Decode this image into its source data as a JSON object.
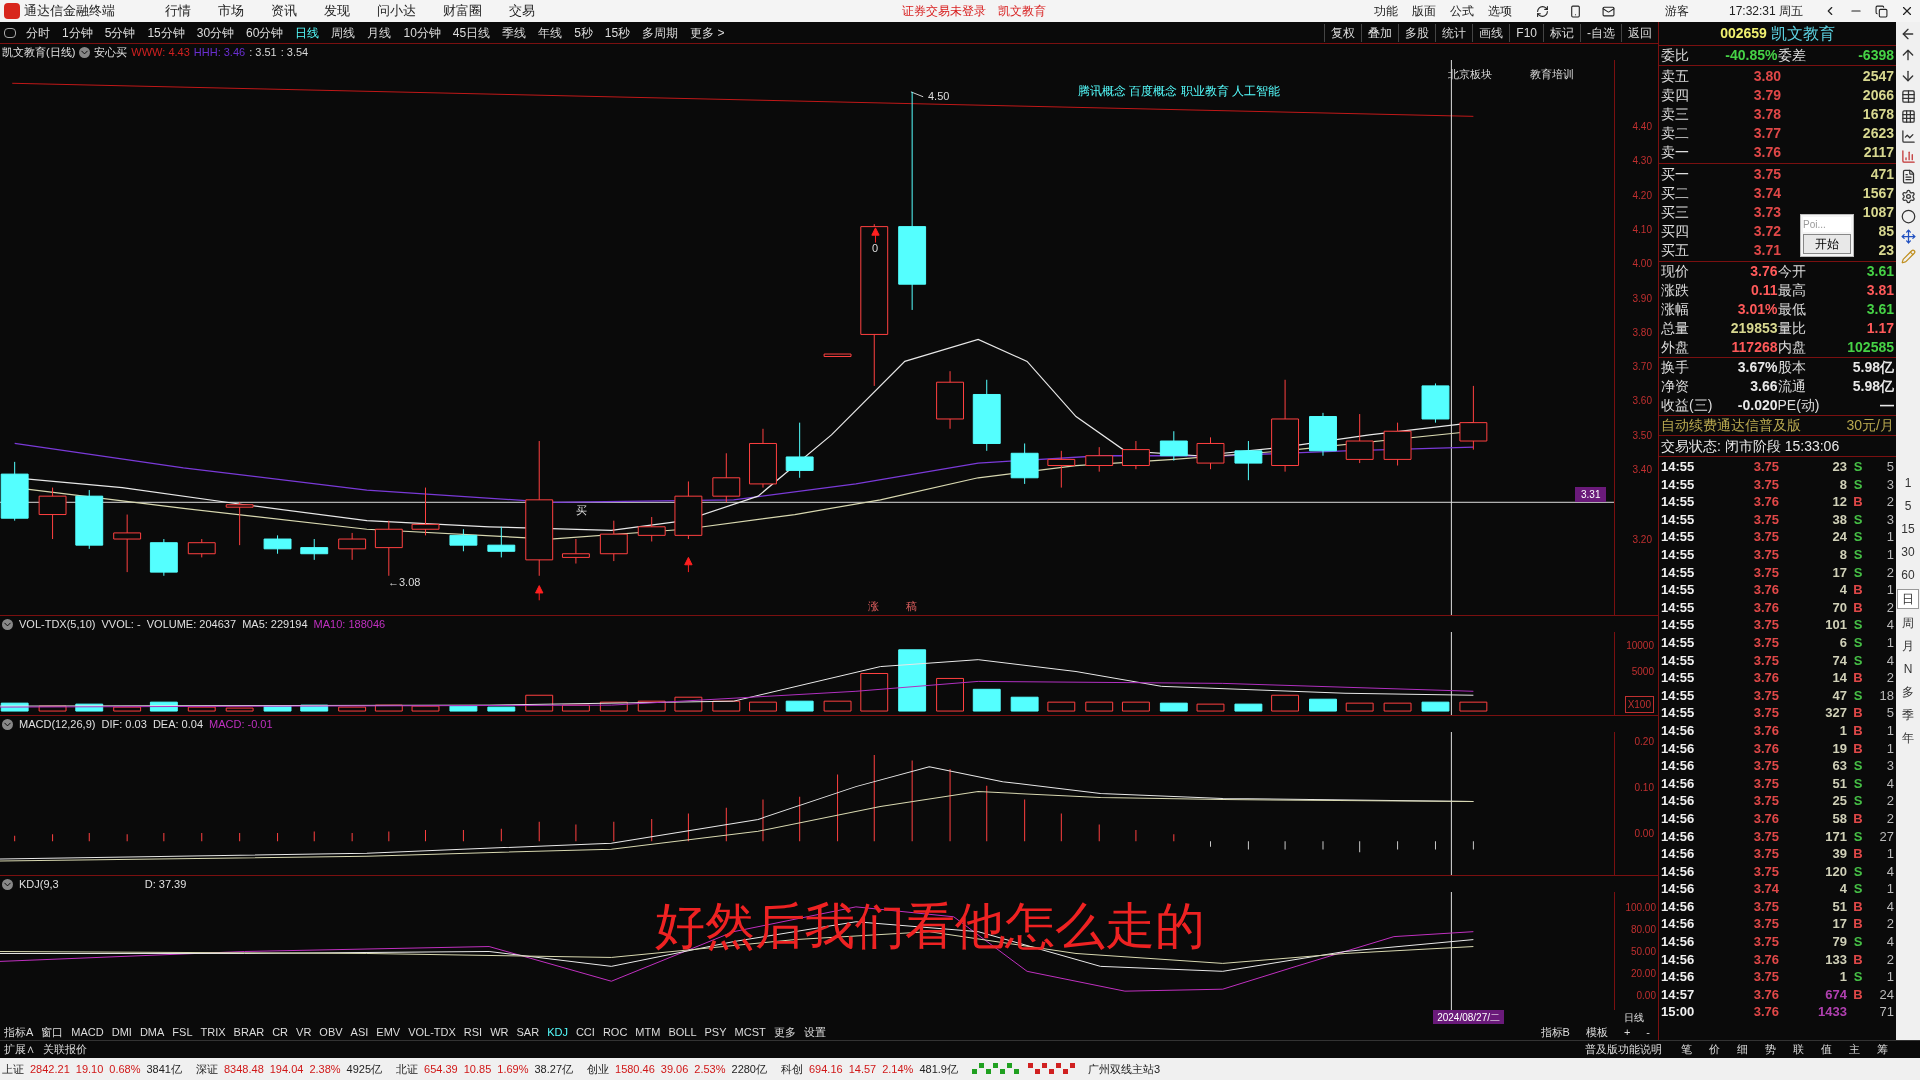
{
  "titlebar": {
    "app_name": "通达信金融终端",
    "menus": [
      "行情",
      "市场",
      "资讯",
      "发现",
      "问小达",
      "财富圈",
      "交易"
    ],
    "notice": "证券交易未登录",
    "stock": "凯文教育",
    "right_menus": [
      "功能",
      "版面",
      "公式",
      "选项"
    ],
    "user": "游客",
    "clock": "17:32:31 周五"
  },
  "periods": [
    {
      "label": "分时",
      "selected": false
    },
    {
      "label": "1分钟",
      "selected": false
    },
    {
      "label": "5分钟",
      "selected": false
    },
    {
      "label": "15分钟",
      "selected": false
    },
    {
      "label": "30分钟",
      "selected": false
    },
    {
      "label": "60分钟",
      "selected": false
    },
    {
      "label": "日线",
      "selected": true
    },
    {
      "label": "周线",
      "selected": false
    },
    {
      "label": "月线",
      "selected": false
    },
    {
      "label": "10分钟",
      "selected": false
    },
    {
      "label": "45日线",
      "selected": false
    },
    {
      "label": "季线",
      "selected": false
    },
    {
      "label": "年线",
      "selected": false
    },
    {
      "label": "5秒",
      "selected": false
    },
    {
      "label": "15秒",
      "selected": false
    },
    {
      "label": "多周期",
      "selected": false
    },
    {
      "label": "更多 >",
      "selected": false
    }
  ],
  "tools": [
    "复权",
    "叠加",
    "多股",
    "统计",
    "画线",
    "F10",
    "标记",
    "-自选",
    "返回"
  ],
  "main_chart": {
    "title": "凯文教育(日线)",
    "tag": "安心买",
    "indicators": [
      {
        "text": "WWW: 4.43",
        "color": "#d02020"
      },
      {
        "text": "HHH: 3.46",
        "color": "#6a2fd0"
      },
      {
        "text": ": 3.51",
        "color": "#d8d8d8"
      },
      {
        "text": ": 3.54",
        "color": "#d8d8d8"
      }
    ],
    "high_label": "4.50",
    "low_label": "←3.08",
    "candle_mark": "0",
    "buy_mark": "买",
    "concepts": "腾讯概念 百度概念 职业教育 人工智能",
    "sector": "北京板块",
    "industry": "教育培训",
    "bottom_marks": [
      "涨",
      "稿"
    ],
    "yticks": [
      "4.40",
      "4.30",
      "4.20",
      "4.10",
      "4.00",
      "3.90",
      "3.80",
      "3.70",
      "3.60",
      "3.50",
      "3.40",
      "3.20"
    ],
    "cursor_price": "3.31"
  },
  "volume_pane": {
    "title": "VOL-TDX(5,10)  VVOL: -  VOLUME: 204637  MA5: 229194",
    "ma10": "MA10: 188046",
    "yticks": [
      "10000",
      "5000"
    ],
    "unit": "X100"
  },
  "macd_pane": {
    "title": "MACD(12,26,9)  DIF: 0.03  DEA: 0.04",
    "macd": "MACD: -0.01",
    "yticks": [
      "0.20",
      "0.10",
      "0.00"
    ]
  },
  "kdj_pane": {
    "title": "KDJ(9,3",
    "d_value": "D: 37.39",
    "yticks": [
      "100.00",
      "80.00",
      "50.00",
      "20.00",
      "0.00"
    ]
  },
  "caption": "好然后我们看他怎么走的",
  "date_label": "2024/08/27/二",
  "period_label": "日线",
  "indicator_tabs": [
    {
      "label": "指标A",
      "selected": false
    },
    {
      "label": "窗口",
      "selected": false
    },
    {
      "label": "MACD",
      "selected": false
    },
    {
      "label": "DMI",
      "selected": false
    },
    {
      "label": "DMA",
      "selected": false
    },
    {
      "label": "FSL",
      "selected": false
    },
    {
      "label": "TRIX",
      "selected": false
    },
    {
      "label": "BRAR",
      "selected": false
    },
    {
      "label": "CR",
      "selected": false
    },
    {
      "label": "VR",
      "selected": false
    },
    {
      "label": "OBV",
      "selected": false
    },
    {
      "label": "ASI",
      "selected": false
    },
    {
      "label": "EMV",
      "selected": false
    },
    {
      "label": "VOL-TDX",
      "selected": false
    },
    {
      "label": "RSI",
      "selected": false
    },
    {
      "label": "WR",
      "selected": false
    },
    {
      "label": "SAR",
      "selected": false
    },
    {
      "label": "KDJ",
      "selected": true
    },
    {
      "label": "CCI",
      "selected": false
    },
    {
      "label": "ROC",
      "selected": false
    },
    {
      "label": "MTM",
      "selected": false
    },
    {
      "label": "BOLL",
      "selected": false
    },
    {
      "label": "PSY",
      "selected": false
    },
    {
      "label": "MCST",
      "selected": false
    },
    {
      "label": "更多",
      "selected": false
    },
    {
      "label": "设置",
      "selected": false
    }
  ],
  "indicator_right": [
    "指标B",
    "模板",
    "+",
    "-"
  ],
  "extension": [
    "扩展∧",
    "关联报价"
  ],
  "quote": {
    "code": "002659",
    "name": "凯文教育",
    "ratio": [
      {
        "label": "委比",
        "value": "-40.85%",
        "color": "#46d246"
      },
      {
        "label": "委差",
        "value": "-6398",
        "color": "#46d246"
      }
    ],
    "asks": [
      {
        "label": "卖五",
        "price": "3.80",
        "volume": "2547"
      },
      {
        "label": "卖四",
        "price": "3.79",
        "volume": "2066"
      },
      {
        "label": "卖三",
        "price": "3.78",
        "volume": "1678"
      },
      {
        "label": "卖二",
        "price": "3.77",
        "volume": "2623"
      },
      {
        "label": "卖一",
        "price": "3.76",
        "volume": "2117"
      }
    ],
    "bids": [
      {
        "label": "买一",
        "price": "3.75",
        "volume": "471"
      },
      {
        "label": "买二",
        "price": "3.74",
        "volume": "1567"
      },
      {
        "label": "买三",
        "price": "3.73",
        "volume": "1087"
      },
      {
        "label": "买四",
        "price": "3.72",
        "volume": "85"
      },
      {
        "label": "买五",
        "price": "3.71",
        "volume": "23"
      }
    ],
    "stats": [
      [
        {
          "label": "现价",
          "value": "3.76",
          "color": "#ff5a5a"
        },
        {
          "label": "今开",
          "value": "3.61",
          "color": "#46d246"
        }
      ],
      [
        {
          "label": "涨跌",
          "value": "0.11",
          "color": "#ff5a5a"
        },
        {
          "label": "最高",
          "value": "3.81",
          "color": "#ff5a5a"
        }
      ],
      [
        {
          "label": "涨幅",
          "value": "3.01%",
          "color": "#ff5a5a"
        },
        {
          "label": "最低",
          "value": "3.61",
          "color": "#46d246"
        }
      ],
      [
        {
          "label": "总量",
          "value": "219853",
          "color": "#d8d890"
        },
        {
          "label": "量比",
          "value": "1.17",
          "color": "#ff5a5a"
        }
      ],
      [
        {
          "label": "外盘",
          "value": "117268",
          "color": "#ff5a5a"
        },
        {
          "label": "内盘",
          "value": "102585",
          "color": "#46d246"
        }
      ]
    ],
    "fundamentals": [
      [
        {
          "label": "换手",
          "value": "3.67%"
        },
        {
          "label": "股本",
          "value": "5.98亿"
        }
      ],
      [
        {
          "label": "净资",
          "value": "3.66"
        },
        {
          "label": "流通",
          "value": "5.98亿"
        }
      ],
      [
        {
          "label": "收益(三)",
          "value": "-0.020"
        },
        {
          "label": "PE(动)",
          "value": "—"
        }
      ]
    ],
    "promo": "自动续费通达信普及版",
    "promo_price": "30元/月",
    "status": "交易状态: 闭市阶段 15:33:06"
  },
  "popup": {
    "field": "Poi...",
    "button": "开始"
  },
  "trades": [
    {
      "time": "14:55",
      "price": "3.75",
      "volume": "23",
      "side": "S",
      "kind": "sell",
      "count": "5",
      "large": false
    },
    {
      "time": "14:55",
      "price": "3.75",
      "volume": "8",
      "side": "S",
      "kind": "sell",
      "count": "3",
      "large": false
    },
    {
      "time": "14:55",
      "price": "3.76",
      "volume": "12",
      "side": "B",
      "kind": "buy",
      "count": "2",
      "large": false
    },
    {
      "time": "14:55",
      "price": "3.75",
      "volume": "38",
      "side": "S",
      "kind": "sell",
      "count": "3",
      "large": false
    },
    {
      "time": "14:55",
      "price": "3.75",
      "volume": "24",
      "side": "S",
      "kind": "sell",
      "count": "1",
      "large": false
    },
    {
      "time": "14:55",
      "price": "3.75",
      "volume": "8",
      "side": "S",
      "kind": "sell",
      "count": "1",
      "large": false
    },
    {
      "time": "14:55",
      "price": "3.75",
      "volume": "17",
      "side": "S",
      "kind": "sell",
      "count": "2",
      "large": false
    },
    {
      "time": "14:55",
      "price": "3.76",
      "volume": "4",
      "side": "B",
      "kind": "buy",
      "count": "1",
      "large": false
    },
    {
      "time": "14:55",
      "price": "3.76",
      "volume": "70",
      "side": "B",
      "kind": "buy",
      "count": "2",
      "large": false
    },
    {
      "time": "14:55",
      "price": "3.75",
      "volume": "101",
      "side": "S",
      "kind": "sell",
      "count": "4",
      "large": false
    },
    {
      "time": "14:55",
      "price": "3.75",
      "volume": "6",
      "side": "S",
      "kind": "sell",
      "count": "1",
      "large": false
    },
    {
      "time": "14:55",
      "price": "3.75",
      "volume": "74",
      "side": "S",
      "kind": "sell",
      "count": "4",
      "large": false
    },
    {
      "time": "14:55",
      "price": "3.76",
      "volume": "14",
      "side": "B",
      "kind": "buy",
      "count": "2",
      "large": false
    },
    {
      "time": "14:55",
      "price": "3.75",
      "volume": "47",
      "side": "S",
      "kind": "sell",
      "count": "18",
      "large": false
    },
    {
      "time": "14:55",
      "price": "3.75",
      "volume": "327",
      "side": "B",
      "kind": "buy",
      "count": "5",
      "large": false
    },
    {
      "time": "14:56",
      "price": "3.76",
      "volume": "1",
      "side": "B",
      "kind": "buy",
      "count": "1",
      "large": false
    },
    {
      "time": "14:56",
      "price": "3.76",
      "volume": "19",
      "side": "B",
      "kind": "buy",
      "count": "1",
      "large": false
    },
    {
      "time": "14:56",
      "price": "3.75",
      "volume": "63",
      "side": "S",
      "kind": "sell",
      "count": "3",
      "large": false
    },
    {
      "time": "14:56",
      "price": "3.75",
      "volume": "51",
      "side": "S",
      "kind": "sell",
      "count": "4",
      "large": false
    },
    {
      "time": "14:56",
      "price": "3.75",
      "volume": "25",
      "side": "S",
      "kind": "sell",
      "count": "2",
      "large": false
    },
    {
      "time": "14:56",
      "price": "3.76",
      "volume": "58",
      "side": "B",
      "kind": "buy",
      "count": "2",
      "large": false
    },
    {
      "time": "14:56",
      "price": "3.75",
      "volume": "171",
      "side": "S",
      "kind": "sell",
      "count": "27",
      "large": false
    },
    {
      "time": "14:56",
      "price": "3.75",
      "volume": "39",
      "side": "B",
      "kind": "buy",
      "count": "1",
      "large": false
    },
    {
      "time": "14:56",
      "price": "3.75",
      "volume": "120",
      "side": "S",
      "kind": "sell",
      "count": "4",
      "large": false
    },
    {
      "time": "14:56",
      "price": "3.74",
      "volume": "4",
      "side": "S",
      "kind": "sell",
      "count": "1",
      "large": false
    },
    {
      "time": "14:56",
      "price": "3.75",
      "volume": "51",
      "side": "B",
      "kind": "buy",
      "count": "4",
      "large": false
    },
    {
      "time": "14:56",
      "price": "3.75",
      "volume": "17",
      "side": "B",
      "kind": "buy",
      "count": "2",
      "large": false
    },
    {
      "time": "14:56",
      "price": "3.75",
      "volume": "79",
      "side": "S",
      "kind": "sell",
      "count": "4",
      "large": false
    },
    {
      "time": "14:56",
      "price": "3.76",
      "volume": "133",
      "side": "B",
      "kind": "buy",
      "count": "2",
      "large": false
    },
    {
      "time": "14:56",
      "price": "3.75",
      "volume": "1",
      "side": "S",
      "kind": "sell",
      "count": "1",
      "large": false
    },
    {
      "time": "14:57",
      "price": "3.76",
      "volume": "674",
      "side": "B",
      "kind": "buy",
      "count": "24",
      "large": true
    },
    {
      "time": "15:00",
      "price": "3.76",
      "volume": "1433",
      "kind": "none",
      "count": "71",
      "large": true
    }
  ],
  "side_periods": [
    {
      "label": "1",
      "selected": false
    },
    {
      "label": "5",
      "selected": false
    },
    {
      "label": "15",
      "selected": false
    },
    {
      "label": "30",
      "selected": false
    },
    {
      "label": "60",
      "selected": false
    },
    {
      "label": "日",
      "selected": true
    },
    {
      "label": "周",
      "selected": false
    },
    {
      "label": "月",
      "selected": false
    },
    {
      "label": "N",
      "selected": false
    },
    {
      "label": "多",
      "selected": false
    },
    {
      "label": "季",
      "selected": false
    },
    {
      "label": "年",
      "selected": false
    }
  ],
  "bottom_tabs": {
    "help": "普及版功能说明",
    "tabs": [
      "笔",
      "价",
      "细",
      "势",
      "联",
      "值",
      "主",
      "筹"
    ]
  },
  "status_bar": {
    "indices": [
      {
        "name": "上证",
        "value": "2842.21",
        "change": "19.10",
        "pct": "0.68%",
        "amount": "3841亿"
      },
      {
        "name": "深证",
        "value": "8348.48",
        "change": "194.04",
        "pct": "2.38%",
        "amount": "4925亿"
      },
      {
        "name": "北证",
        "value": "654.39",
        "change": "10.85",
        "pct": "1.69%",
        "amount": "38.27亿"
      },
      {
        "name": "创业",
        "value": "1580.46",
        "change": "39.06",
        "pct": "2.53%",
        "amount": "2280亿"
      },
      {
        "name": "科创",
        "value": "694.16",
        "change": "14.57",
        "pct": "2.14%",
        "amount": "481.9亿"
      }
    ],
    "server": "广州双线主站3"
  }
}
